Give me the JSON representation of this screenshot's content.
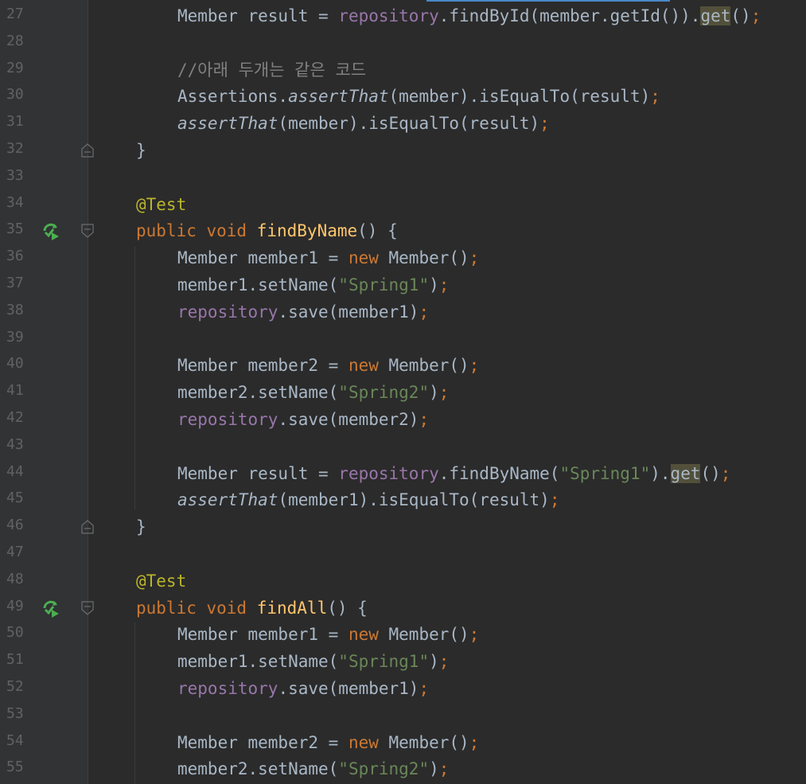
{
  "editor": {
    "colors": {
      "background": "#2b2b2b",
      "gutter": "#313335",
      "line_number": "#606366",
      "default_text": "#a9b7c6",
      "keyword": "#cc7832",
      "string": "#6a8759",
      "field": "#9876aa",
      "method_decl": "#ffc66d",
      "annotation": "#bbb529",
      "comment": "#808080",
      "run_icon": "#4caf50"
    },
    "lines": [
      {
        "n": "27",
        "indent": 2,
        "tokens": [
          {
            "t": "Member result = "
          },
          {
            "t": "repository",
            "c": "fld"
          },
          {
            "t": ".findById(member.getId())."
          },
          {
            "t": "get",
            "c": "hl"
          },
          {
            "t": "()"
          },
          {
            "t": ";",
            "c": "kw"
          }
        ]
      },
      {
        "n": "28",
        "indent": 2,
        "tokens": []
      },
      {
        "n": "29",
        "indent": 2,
        "tokens": [
          {
            "t": "//아래 두개는 같은 코드",
            "c": "cmt"
          }
        ]
      },
      {
        "n": "30",
        "indent": 2,
        "tokens": [
          {
            "t": "Assertions."
          },
          {
            "t": "assertThat",
            "c": "it"
          },
          {
            "t": "(member).isEqualTo(result)"
          },
          {
            "t": ";",
            "c": "kw"
          }
        ]
      },
      {
        "n": "31",
        "indent": 2,
        "tokens": [
          {
            "t": "assertThat",
            "c": "it"
          },
          {
            "t": "(member).isEqualTo(result)"
          },
          {
            "t": ";",
            "c": "kw"
          }
        ]
      },
      {
        "n": "32",
        "indent": 1,
        "fold": "end",
        "tokens": [
          {
            "t": "}"
          }
        ]
      },
      {
        "n": "33",
        "indent": 1,
        "tokens": []
      },
      {
        "n": "34",
        "indent": 1,
        "tokens": [
          {
            "t": "@Test",
            "c": "ann"
          }
        ]
      },
      {
        "n": "35",
        "indent": 1,
        "run": true,
        "fold": "start",
        "tokens": [
          {
            "t": "public void ",
            "c": "kw"
          },
          {
            "t": "findByName",
            "c": "fn"
          },
          {
            "t": "() {"
          }
        ]
      },
      {
        "n": "36",
        "indent": 2,
        "tokens": [
          {
            "t": "Member member1 = "
          },
          {
            "t": "new ",
            "c": "kw"
          },
          {
            "t": "Member()"
          },
          {
            "t": ";",
            "c": "kw"
          }
        ]
      },
      {
        "n": "37",
        "indent": 2,
        "tokens": [
          {
            "t": "member1.setName("
          },
          {
            "t": "\"Spring1\"",
            "c": "str"
          },
          {
            "t": ")"
          },
          {
            "t": ";",
            "c": "kw"
          }
        ]
      },
      {
        "n": "38",
        "indent": 2,
        "tokens": [
          {
            "t": "repository",
            "c": "fld"
          },
          {
            "t": ".save(member1)"
          },
          {
            "t": ";",
            "c": "kw"
          }
        ]
      },
      {
        "n": "39",
        "indent": 2,
        "tokens": []
      },
      {
        "n": "40",
        "indent": 2,
        "tokens": [
          {
            "t": "Member member2 = "
          },
          {
            "t": "new ",
            "c": "kw"
          },
          {
            "t": "Member()"
          },
          {
            "t": ";",
            "c": "kw"
          }
        ]
      },
      {
        "n": "41",
        "indent": 2,
        "tokens": [
          {
            "t": "member2.setName("
          },
          {
            "t": "\"Spring2\"",
            "c": "str"
          },
          {
            "t": ")"
          },
          {
            "t": ";",
            "c": "kw"
          }
        ]
      },
      {
        "n": "42",
        "indent": 2,
        "tokens": [
          {
            "t": "repository",
            "c": "fld"
          },
          {
            "t": ".save(member2)"
          },
          {
            "t": ";",
            "c": "kw"
          }
        ]
      },
      {
        "n": "43",
        "indent": 2,
        "tokens": []
      },
      {
        "n": "44",
        "indent": 2,
        "tokens": [
          {
            "t": "Member result = "
          },
          {
            "t": "repository",
            "c": "fld"
          },
          {
            "t": ".findByName("
          },
          {
            "t": "\"Spring1\"",
            "c": "str"
          },
          {
            "t": ")."
          },
          {
            "t": "get",
            "c": "hl"
          },
          {
            "t": "()"
          },
          {
            "t": ";",
            "c": "kw"
          }
        ]
      },
      {
        "n": "45",
        "indent": 2,
        "tokens": [
          {
            "t": "assertThat",
            "c": "it"
          },
          {
            "t": "(member1).isEqualTo(result)"
          },
          {
            "t": ";",
            "c": "kw"
          }
        ]
      },
      {
        "n": "46",
        "indent": 1,
        "fold": "end",
        "tokens": [
          {
            "t": "}"
          }
        ]
      },
      {
        "n": "47",
        "indent": 1,
        "tokens": []
      },
      {
        "n": "48",
        "indent": 1,
        "tokens": [
          {
            "t": "@Test",
            "c": "ann"
          }
        ]
      },
      {
        "n": "49",
        "indent": 1,
        "run": true,
        "fold": "start",
        "tokens": [
          {
            "t": "public void ",
            "c": "kw"
          },
          {
            "t": "findAll",
            "c": "fn"
          },
          {
            "t": "() {"
          }
        ]
      },
      {
        "n": "50",
        "indent": 2,
        "tokens": [
          {
            "t": "Member member1 = "
          },
          {
            "t": "new ",
            "c": "kw"
          },
          {
            "t": "Member()"
          },
          {
            "t": ";",
            "c": "kw"
          }
        ]
      },
      {
        "n": "51",
        "indent": 2,
        "tokens": [
          {
            "t": "member1.setName("
          },
          {
            "t": "\"Spring1\"",
            "c": "str"
          },
          {
            "t": ")"
          },
          {
            "t": ";",
            "c": "kw"
          }
        ]
      },
      {
        "n": "52",
        "indent": 2,
        "tokens": [
          {
            "t": "repository",
            "c": "fld"
          },
          {
            "t": ".save(member1)"
          },
          {
            "t": ";",
            "c": "kw"
          }
        ]
      },
      {
        "n": "53",
        "indent": 2,
        "tokens": []
      },
      {
        "n": "54",
        "indent": 2,
        "tokens": [
          {
            "t": "Member member2 = "
          },
          {
            "t": "new ",
            "c": "kw"
          },
          {
            "t": "Member()"
          },
          {
            "t": ";",
            "c": "kw"
          }
        ]
      },
      {
        "n": "55",
        "indent": 2,
        "tokens": [
          {
            "t": "member2.setName("
          },
          {
            "t": "\"Spring2\"",
            "c": "str"
          },
          {
            "t": ")"
          },
          {
            "t": ";",
            "c": "kw"
          }
        ]
      }
    ]
  }
}
